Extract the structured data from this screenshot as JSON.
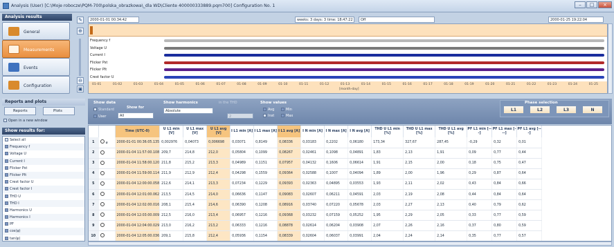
{
  "window": {
    "title": "Analysis (User) [C:\\Moje robocze\\PQM-700\\polska_obrazkowa\\_dla WD\\Cliente 400000333889.pqm700] Configuration No. 1",
    "min": "–",
    "max": "□",
    "close": "×"
  },
  "sidebar": {
    "header": "Analysis results",
    "items": [
      {
        "label": "General",
        "color": "#d98a2c"
      },
      {
        "label": "Measurements",
        "color": "#ffffff"
      },
      {
        "label": "Events",
        "color": "#3f72bf"
      },
      {
        "label": "Configuration",
        "color": "#d98a2c"
      }
    ]
  },
  "reports": {
    "header": "Reports and plots",
    "reports_label": "Reports",
    "plots_label": "Plots",
    "open_window": "Open in a new window",
    "results_header": "Show results for:",
    "items": [
      "Select all",
      "Frequency f",
      "Voltage U",
      "Current I",
      "Flicker Pst",
      "Flicker Plt",
      "Crest factor U",
      "Crest factor I",
      "THD U",
      "THD I",
      "Harmonics U",
      "Harmonics I",
      "PF",
      "cos(φ)",
      "tan(φ)"
    ],
    "checked": [
      false,
      true,
      true,
      true,
      true,
      true,
      true,
      true,
      true,
      true,
      true,
      true,
      true,
      true,
      true
    ]
  },
  "toolbar": {
    "start_time": "2000-01-01 00:34:42",
    "duration": "weeks: 3 days: 3 time: 18:47:22",
    "mode": "Off",
    "end_time": "2000-01-25 19:22:04"
  },
  "timeline": {
    "channels": [
      {
        "label": "Frequency f",
        "color": "#b8b8b8"
      },
      {
        "label": "Voltage U",
        "color": "#7a7a7a"
      },
      {
        "label": "Current I",
        "color": "#1a2d9e"
      },
      {
        "label": "Flicker Pst",
        "color": "#b22a2a"
      },
      {
        "label": "Flicker Plt",
        "color": "#5a1f8a"
      },
      {
        "label": "Crest factor U",
        "color": "#2a44b8"
      }
    ],
    "ticks": [
      "01-01",
      "01-02",
      "01-03",
      "01-04",
      "01-05",
      "01-06",
      "01-07",
      "01-08",
      "01-09",
      "01-10",
      "01-11",
      "01-12",
      "01-13",
      "01-14",
      "01-15",
      "01-16",
      "01-17",
      "01-18",
      "01-19",
      "01-20",
      "01-21",
      "01-22",
      "01-23",
      "01-24",
      "01-25"
    ],
    "axis_unit": "[month-day]",
    "series_start_fraction": 0.146,
    "series_end_fraction": 0.995
  },
  "show_data": {
    "title": "Show data",
    "standard": "Standard",
    "user": "User",
    "show_for": "Show for",
    "show_for_value": "All"
  },
  "show_harmonics": {
    "title": "Show harmonics",
    "value": "Absolute",
    "in_thd": "in the THD",
    "value2": "2"
  },
  "show_values": {
    "title": "Show values",
    "avg": "Avg",
    "min": "Min",
    "inst": "Inst",
    "max": "Max"
  },
  "phase": {
    "title": "Phase selection",
    "buttons": [
      "L1",
      "L2",
      "L3",
      "N"
    ]
  },
  "table": {
    "columns": [
      "",
      "",
      "Time (UTC-0)",
      "U L1 min [V]",
      "U L1 max [V]",
      "U L1 avg [V]",
      "I L1 min [A]",
      "I L1 max [A]",
      "I L1 avg [A]",
      "I N min [A]",
      "I N max [A]",
      "I N avg [A]",
      "THD U L1 min [%]",
      "THD U L1 max [%]",
      "THD U L1 avg [%]",
      "PF L1 min [---]",
      "PF L1 max [---]",
      "PF L1 avg [---]"
    ],
    "rows": [
      [
        "1",
        "2000-01-01 00:36:05.135",
        "0,002976",
        "0,04073",
        "0,006698",
        "0,03071",
        "0,8149",
        "0,08336",
        "0,03183",
        "0,2202",
        "0,06180",
        "173,34",
        "327,67",
        "287,45",
        "-0,29",
        "0,32",
        "0,01"
      ],
      [
        "2",
        "2000-01-04 11:57:00.108",
        "209,7",
        "214,8",
        "212,0",
        "0,05804",
        "0,1099",
        "0,08267",
        "0,02461",
        "0,1098",
        "0,04891",
        "1,83",
        "2,13",
        "1,91",
        "0,09",
        "0,77",
        "0,44"
      ],
      [
        "3",
        "2000-01-04 11:58:00.120",
        "211,8",
        "215,2",
        "213,3",
        "0,04989",
        "0,1151",
        "0,07957",
        "0,04132",
        "0,1606",
        "0,06614",
        "1,91",
        "2,15",
        "2,00",
        "0,18",
        "0,75",
        "0,47"
      ],
      [
        "4",
        "2000-01-04 11:59:00.114",
        "211,9",
        "212,9",
        "212,4",
        "0,04298",
        "0,1559",
        "0,09364",
        "0,02588",
        "0,1007",
        "0,04094",
        "1,89",
        "2,00",
        "1,96",
        "0,29",
        "0,87",
        "0,64"
      ],
      [
        "5",
        "2000-01-04 12:00:00.058",
        "212,6",
        "214,1",
        "213,3",
        "0,07234",
        "0,1229",
        "0,09393",
        "0,02363",
        "0,04895",
        "0,03553",
        "1,93",
        "2,11",
        "2,02",
        "0,43",
        "0,84",
        "0,66"
      ],
      [
        "6",
        "2000-01-04 12:01:00.062",
        "213,5",
        "214,5",
        "214,0",
        "0,06636",
        "0,1147",
        "0,09083",
        "0,02607",
        "0,06211",
        "0,04591",
        "2,03",
        "2,19",
        "2,08",
        "0,44",
        "0,84",
        "0,64"
      ],
      [
        "7",
        "2000-01-04 12:02:00.016",
        "208,1",
        "215,4",
        "214,6",
        "0,06390",
        "0,1208",
        "0,08916",
        "0,03740",
        "0,07220",
        "0,05678",
        "2,03",
        "2,27",
        "2,13",
        "0,40",
        "0,79",
        "0,62"
      ],
      [
        "8",
        "2000-01-04 12:03:00.009",
        "212,5",
        "216,0",
        "213,4",
        "0,06957",
        "0,1216",
        "0,09368",
        "0,03232",
        "0,07159",
        "0,05252",
        "1,95",
        "2,29",
        "2,05",
        "0,33",
        "0,77",
        "0,59"
      ],
      [
        "9",
        "2000-01-04 12:04:00.029",
        "213,0",
        "216,2",
        "213,2",
        "0,06333",
        "0,1216",
        "0,08878",
        "0,02614",
        "0,06204",
        "0,03908",
        "2,07",
        "2,26",
        "2,16",
        "0,37",
        "0,80",
        "0,59"
      ],
      [
        "10",
        "2000-01-04 12:05:00.036",
        "209,1",
        "215,8",
        "212,4",
        "0,05936",
        "0,1154",
        "0,08339",
        "0,02604",
        "0,06037",
        "0,03991",
        "2,04",
        "2,24",
        "2,14",
        "0,35",
        "0,77",
        "0,57"
      ]
    ]
  }
}
